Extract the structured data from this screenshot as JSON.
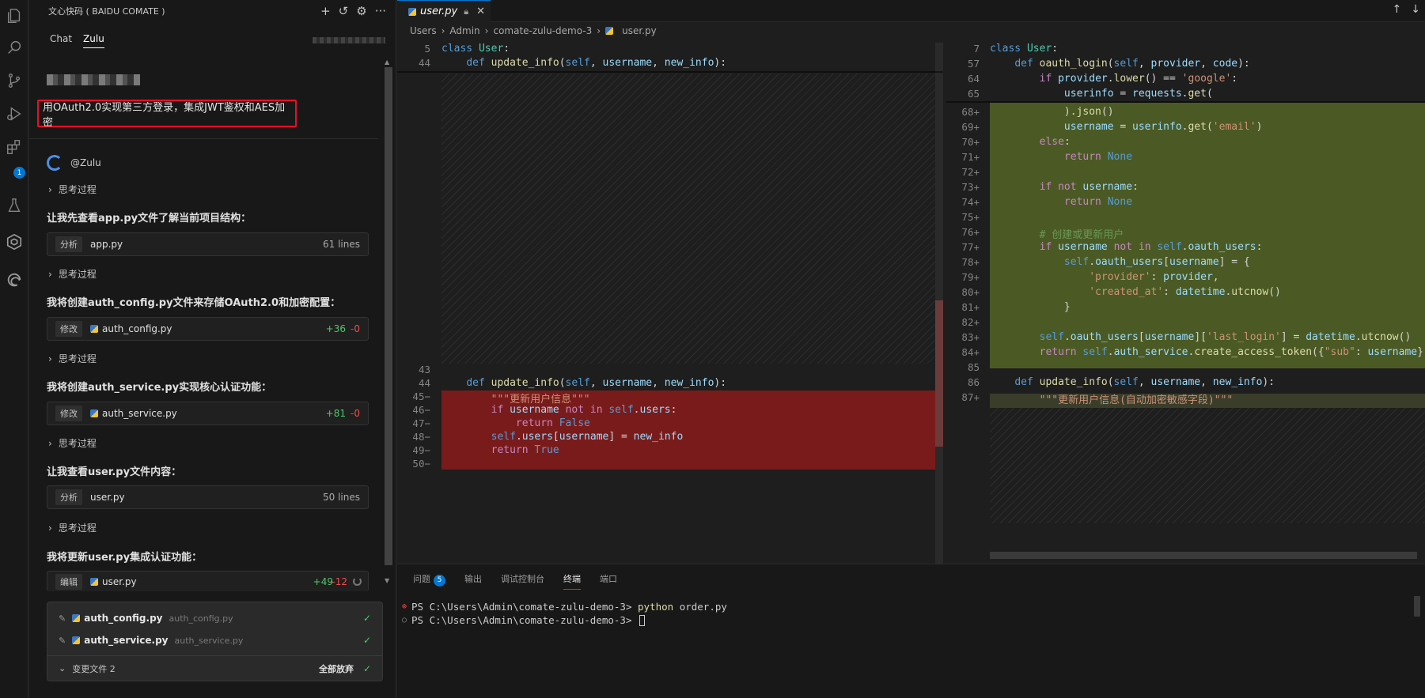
{
  "sidebar": {
    "header_title": "文心快码 ( BAIDU COMATE )",
    "tabs": [
      "Chat",
      "Zulu"
    ],
    "user_prompt": "用OAuth2.0实现第三方登录，集成JWT鉴权和AES加密",
    "agent_name": "@Zulu",
    "thinking_label": "思考过程",
    "messages": [
      "让我先查看app.py文件了解当前项目结构：",
      "我将创建auth_config.py文件来存储OAuth2.0和加密配置：",
      "我将创建auth_service.py实现核心认证功能：",
      "让我查看user.py文件内容：",
      "我将更新user.py集成认证功能："
    ],
    "cards": [
      {
        "tag": "分析",
        "file": "app.py",
        "lines": "61 lines"
      },
      {
        "tag": "修改",
        "file": "auth_config.py",
        "adds": "+36",
        "dels": "-0"
      },
      {
        "tag": "修改",
        "file": "auth_service.py",
        "adds": "+81",
        "dels": "-0"
      },
      {
        "tag": "分析",
        "file": "user.py",
        "lines": "50 lines"
      },
      {
        "tag": "编辑",
        "file": "user.py",
        "adds": "+49",
        "dels": "-12"
      }
    ],
    "changes": {
      "files": [
        {
          "name": "auth_config.py",
          "path": "auth_config.py"
        },
        {
          "name": "auth_service.py",
          "path": "auth_service.py"
        }
      ],
      "summary": "变更文件 2",
      "discard_label": "全部放弃"
    }
  },
  "editor": {
    "tab_label": "user.py",
    "breadcrumb": [
      "Users",
      "Admin",
      "comate-zulu-demo-3",
      "user.py"
    ],
    "left_sticky": [
      {
        "ln": "5",
        "code": "class User:"
      },
      {
        "ln": "44",
        "code": "    def update_info(self, username, new_info):"
      }
    ],
    "left_lines": [
      {
        "ln": "43",
        "code": ""
      },
      {
        "ln": "44",
        "code": "    def update_info(self, username, new_info):"
      },
      {
        "ln": "45−",
        "code": "        \"\"\"更新用户信息\"\"\""
      },
      {
        "ln": "46−",
        "code": "        if username not in self.users:"
      },
      {
        "ln": "47−",
        "code": "            return False"
      },
      {
        "ln": "48−",
        "code": "        self.users[username] = new_info"
      },
      {
        "ln": "49−",
        "code": "        return True"
      },
      {
        "ln": "50−",
        "code": ""
      }
    ],
    "right_sticky": [
      {
        "ln": "7",
        "code": "class User:"
      },
      {
        "ln": "57",
        "code": "    def oauth_login(self, provider, code):"
      },
      {
        "ln": "64",
        "code": "        if provider.lower() == 'google':"
      },
      {
        "ln": "65",
        "code": "            userinfo = requests.get("
      }
    ],
    "right_lines": [
      {
        "ln": "68+",
        "code": "            ).json()"
      },
      {
        "ln": "69+",
        "code": "            username = userinfo.get('email')"
      },
      {
        "ln": "70+",
        "code": "        else:"
      },
      {
        "ln": "71+",
        "code": "            return None"
      },
      {
        "ln": "72+",
        "code": ""
      },
      {
        "ln": "73+",
        "code": "        if not username:"
      },
      {
        "ln": "74+",
        "code": "            return None"
      },
      {
        "ln": "75+",
        "code": ""
      },
      {
        "ln": "76+",
        "code": "        # 创建或更新用户"
      },
      {
        "ln": "77+",
        "code": "        if username not in self.oauth_users:"
      },
      {
        "ln": "78+",
        "code": "            self.oauth_users[username] = {"
      },
      {
        "ln": "79+",
        "code": "                'provider': provider,"
      },
      {
        "ln": "80+",
        "code": "                'created_at': datetime.utcnow()"
      },
      {
        "ln": "81+",
        "code": "            }"
      },
      {
        "ln": "82+",
        "code": ""
      },
      {
        "ln": "83+",
        "code": "        self.oauth_users[username]['last_login'] = datetime.utcnow()"
      },
      {
        "ln": "84+",
        "code": "        return self.auth_service.create_access_token({\"sub\": username})"
      },
      {
        "ln": "85",
        "code": ""
      },
      {
        "ln": "86",
        "code": "    def update_info(self, username, new_info):"
      },
      {
        "ln": "87+",
        "code": "        \"\"\"更新用户信息(自动加密敏感字段)\"\"\""
      }
    ]
  },
  "panel": {
    "tabs": [
      "问题",
      "输出",
      "调试控制台",
      "终端",
      "端口"
    ],
    "problems_count": "5",
    "terminal": [
      {
        "prompt": "PS C:\\Users\\Admin\\comate-zulu-demo-3> ",
        "cmd": "python",
        "args": " order.py"
      },
      {
        "prompt": "PS C:\\Users\\Admin\\comate-zulu-demo-3> ",
        "cmd": "",
        "args": ""
      }
    ]
  },
  "activity_badge": "1",
  "icons": [
    "explorer-icon",
    "search-icon",
    "source-control-icon",
    "run-debug-icon",
    "extensions-icon",
    "testing-icon",
    "comate-icon",
    "edge-icon"
  ]
}
